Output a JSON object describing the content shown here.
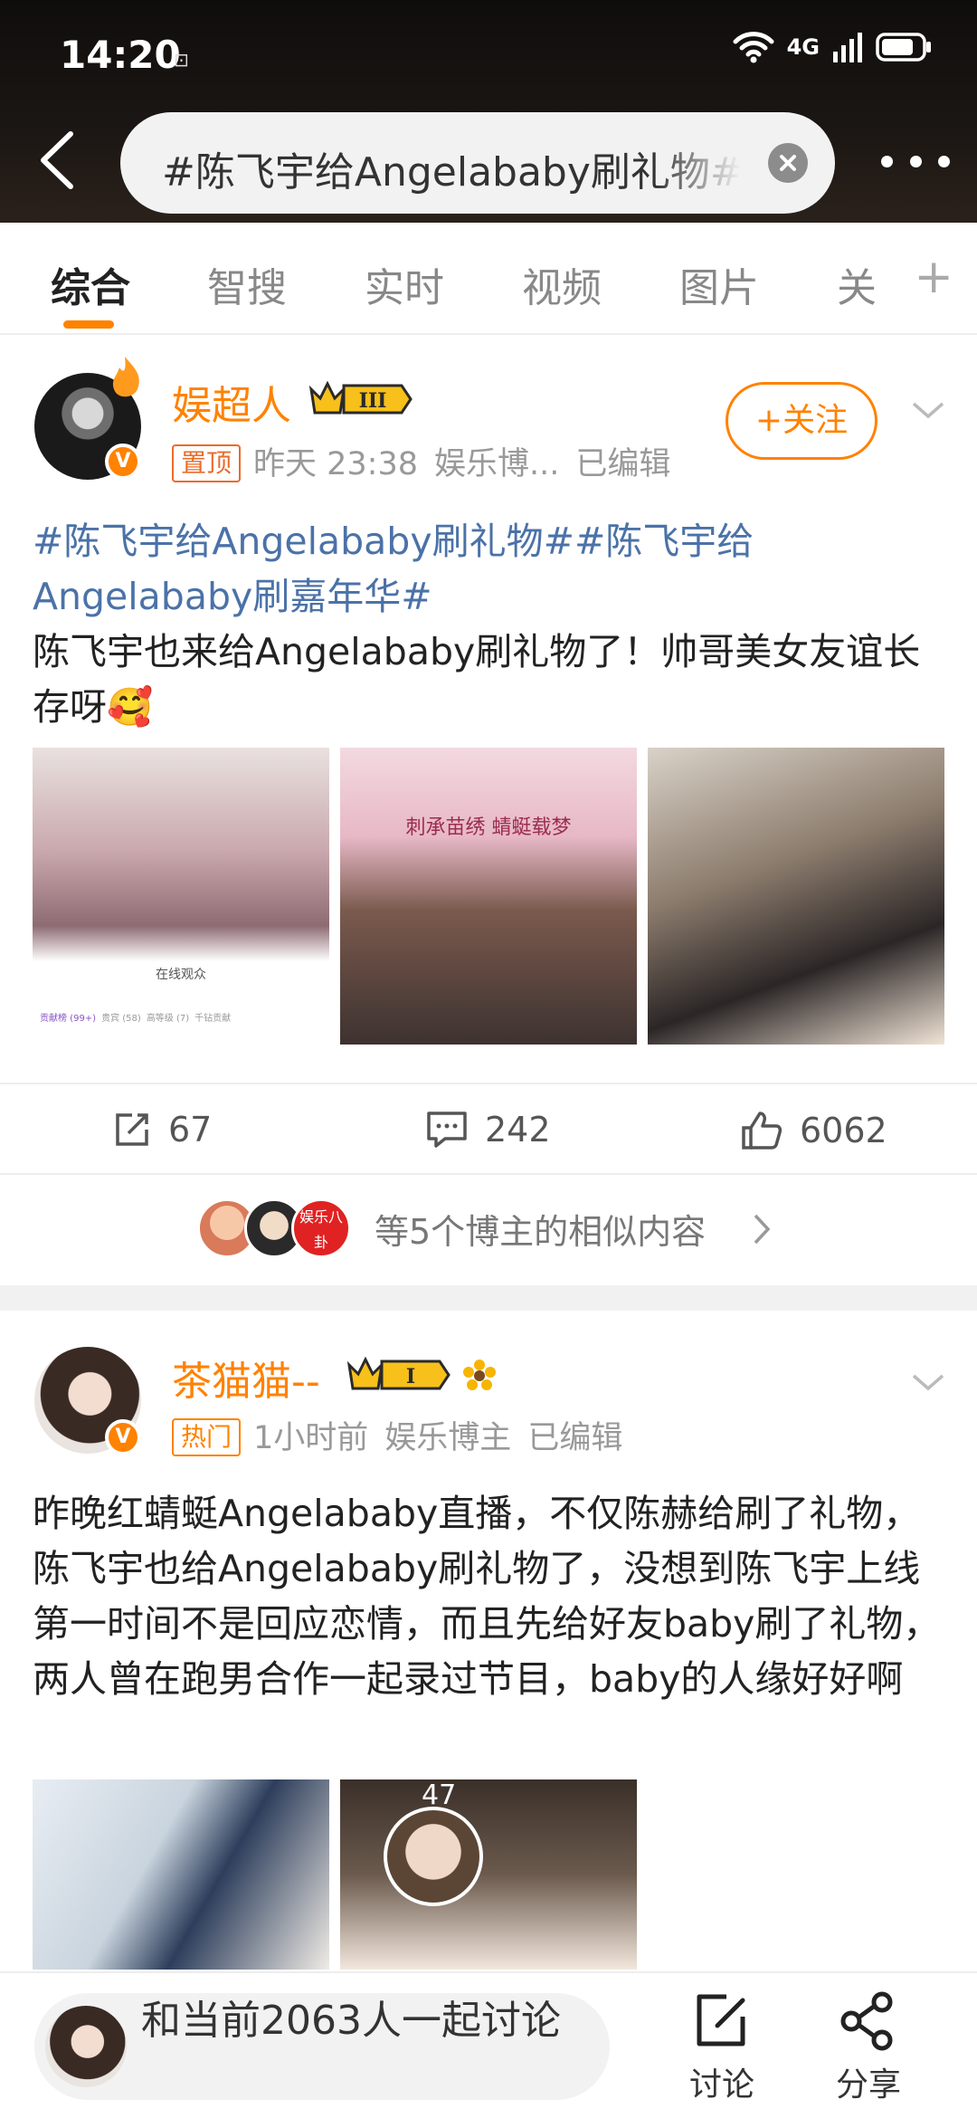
{
  "status_bar": {
    "time": "14:20",
    "network": "4G",
    "sim_icon": "sim-icon"
  },
  "search": {
    "query": "#陈飞宇给Angelababy刷礼物#"
  },
  "tabs": [
    {
      "label": "综合",
      "active": true
    },
    {
      "label": "智搜"
    },
    {
      "label": "实时"
    },
    {
      "label": "视频"
    },
    {
      "label": "图片"
    },
    {
      "label": "关"
    }
  ],
  "posts": [
    {
      "username": "娱超人",
      "level": "III",
      "tag": "置顶",
      "time": "昨天 23:38",
      "source": "娱乐博...",
      "edited": "已编辑",
      "follow_label": "+关注",
      "hashtags": "#陈飞宇给Angelababy刷礼物##陈飞宇给Angelababy刷嘉年华#",
      "text": "陈飞宇也来给Angelababy刷礼物了！帅哥美女友谊长存呀🥰",
      "images": [
        {
          "caption": "在线观众",
          "chips": [
            "贡献榜 (99+)",
            "贵宾 (58)",
            "高等级 (7)",
            "千钻贡献"
          ]
        },
        {
          "caption": "刺承苗绣 蜻蜓载梦"
        },
        {
          "caption": ""
        }
      ],
      "reposts": "67",
      "comments": "242",
      "likes": "6062",
      "related_text": "等5个博主的相似内容",
      "related_badge": "娱乐八卦"
    },
    {
      "username": "茶猫猫--",
      "level": "I",
      "tag": "热门",
      "time": "1小时前",
      "source": "娱乐博主",
      "edited": "已编辑",
      "text": "昨晚红蜻蜓Angelababy直播，不仅陈赫给刷了礼物，陈飞宇也给Angelababy刷礼物了，没想到陈飞宇上线第一时间不是回应恋情，而且先给好友baby刷了礼物，两人曾在跑男合作一起录过节目，baby的人缘好好啊",
      "image_overlay": "47"
    }
  ],
  "bottom_bar": {
    "discuss_text": "和当前2063人一起讨论",
    "discuss_label": "讨论",
    "share_label": "分享"
  },
  "colors": {
    "accent": "#ff8200",
    "link": "#4b72a8",
    "dark_header": "#1c1714"
  }
}
